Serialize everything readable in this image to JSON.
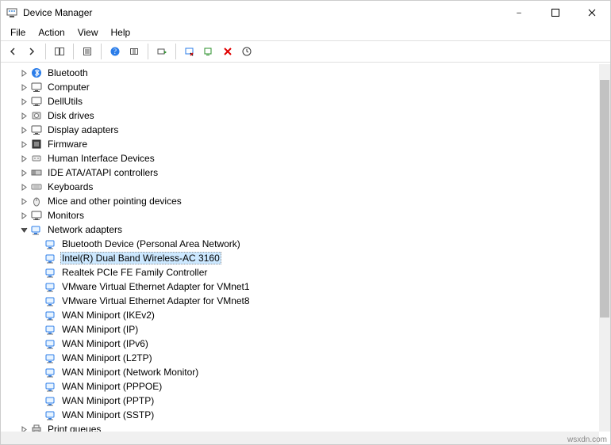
{
  "window": {
    "title": "Device Manager"
  },
  "menu": {
    "file": "File",
    "action": "Action",
    "view": "View",
    "help": "Help"
  },
  "tree": {
    "bluetooth": "Bluetooth",
    "computer": "Computer",
    "dellutils": "DellUtils",
    "diskdrives": "Disk drives",
    "display": "Display adapters",
    "firmware": "Firmware",
    "hid": "Human Interface Devices",
    "ide": "IDE ATA/ATAPI controllers",
    "keyboards": "Keyboards",
    "mice": "Mice and other pointing devices",
    "monitors": "Monitors",
    "network": "Network adapters",
    "net_items": [
      "Bluetooth Device (Personal Area Network)",
      "Intel(R) Dual Band Wireless-AC 3160",
      "Realtek PCIe FE Family Controller",
      "VMware Virtual Ethernet Adapter for VMnet1",
      "VMware Virtual Ethernet Adapter for VMnet8",
      "WAN Miniport (IKEv2)",
      "WAN Miniport (IP)",
      "WAN Miniport (IPv6)",
      "WAN Miniport (L2TP)",
      "WAN Miniport (Network Monitor)",
      "WAN Miniport (PPPOE)",
      "WAN Miniport (PPTP)",
      "WAN Miniport (SSTP)"
    ],
    "printqueues": "Print queues"
  },
  "watermark": "wsxdn.com",
  "selected_index": 1
}
